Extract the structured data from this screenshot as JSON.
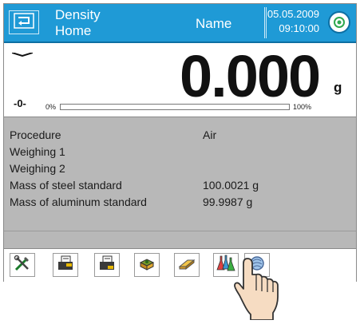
{
  "header": {
    "title_line1": "Density",
    "title_line2": "Home",
    "user_name": "Name",
    "date": "05.05.2009",
    "time": "09:10:00"
  },
  "display": {
    "value": "0.000",
    "unit": "g",
    "zero_indicator": "-0-",
    "bar_min_label": "0%",
    "bar_max_label": "100%",
    "bar_fill_percent": 0
  },
  "info": {
    "rows": [
      {
        "label": "Procedure",
        "value": "Air"
      },
      {
        "label": "Weighing 1",
        "value": ""
      },
      {
        "label": "Weighing 2",
        "value": ""
      },
      {
        "label": "Mass of steel standard",
        "value": "100.0021 g"
      },
      {
        "label": "Mass of aluminum standard",
        "value": "99.9987 g"
      }
    ]
  },
  "toolbar": {
    "buttons": [
      {
        "icon": "tools-icon"
      },
      {
        "icon": "printer-header-icon"
      },
      {
        "icon": "printer-footer-icon"
      },
      {
        "icon": "weighing-pan-icon"
      },
      {
        "icon": "eraser-icon"
      },
      {
        "icon": "flasks-icon"
      },
      {
        "icon": "sinker-icon"
      }
    ]
  },
  "colors": {
    "header_bg": "#1f9ad6",
    "panel_bg": "#b8b8b8",
    "accent": "#0d6fa3"
  }
}
